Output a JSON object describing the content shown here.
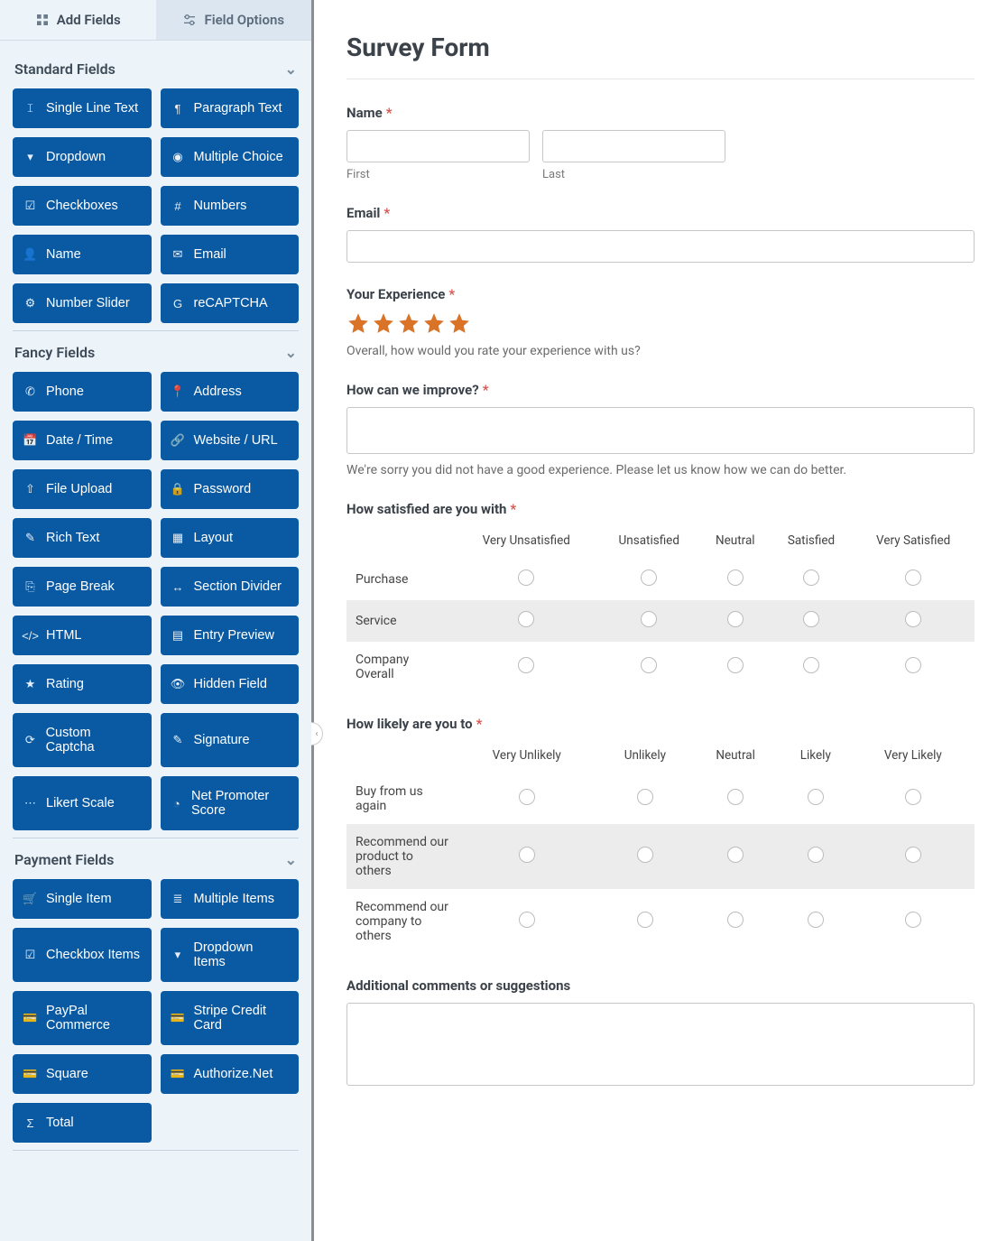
{
  "tabs": {
    "add": "Add Fields",
    "options": "Field Options"
  },
  "sections": {
    "standard": {
      "title": "Standard Fields",
      "items": [
        {
          "icon": "𝙸",
          "label": "Single Line Text"
        },
        {
          "icon": "¶",
          "label": "Paragraph Text"
        },
        {
          "icon": "▾",
          "label": "Dropdown"
        },
        {
          "icon": "◉",
          "label": "Multiple Choice"
        },
        {
          "icon": "☑",
          "label": "Checkboxes"
        },
        {
          "icon": "#",
          "label": "Numbers"
        },
        {
          "icon": "👤",
          "label": "Name"
        },
        {
          "icon": "✉",
          "label": "Email"
        },
        {
          "icon": "⚙",
          "label": "Number Slider"
        },
        {
          "icon": "G",
          "label": "reCAPTCHA"
        }
      ]
    },
    "fancy": {
      "title": "Fancy Fields",
      "items": [
        {
          "icon": "✆",
          "label": "Phone"
        },
        {
          "icon": "📍",
          "label": "Address"
        },
        {
          "icon": "📅",
          "label": "Date / Time"
        },
        {
          "icon": "🔗",
          "label": "Website / URL"
        },
        {
          "icon": "⇧",
          "label": "File Upload"
        },
        {
          "icon": "🔒",
          "label": "Password"
        },
        {
          "icon": "✎",
          "label": "Rich Text"
        },
        {
          "icon": "▦",
          "label": "Layout"
        },
        {
          "icon": "⎘",
          "label": "Page Break"
        },
        {
          "icon": "↔",
          "label": "Section Divider"
        },
        {
          "icon": "</>",
          "label": "HTML"
        },
        {
          "icon": "▤",
          "label": "Entry Preview"
        },
        {
          "icon": "★",
          "label": "Rating"
        },
        {
          "icon": "👁",
          "label": "Hidden Field"
        },
        {
          "icon": "⟳",
          "label": "Custom Captcha"
        },
        {
          "icon": "✎",
          "label": "Signature"
        },
        {
          "icon": "⋯",
          "label": "Likert Scale"
        },
        {
          "icon": "◔",
          "label": "Net Promoter Score"
        }
      ]
    },
    "payment": {
      "title": "Payment Fields",
      "items": [
        {
          "icon": "🛒",
          "label": "Single Item"
        },
        {
          "icon": "≣",
          "label": "Multiple Items"
        },
        {
          "icon": "☑",
          "label": "Checkbox Items"
        },
        {
          "icon": "▾",
          "label": "Dropdown Items"
        },
        {
          "icon": "💳",
          "label": "PayPal Commerce"
        },
        {
          "icon": "💳",
          "label": "Stripe Credit Card"
        },
        {
          "icon": "💳",
          "label": "Square"
        },
        {
          "icon": "💳",
          "label": "Authorize.Net"
        },
        {
          "icon": "Σ",
          "label": "Total"
        }
      ]
    }
  },
  "form": {
    "title": "Survey Form",
    "name": {
      "label": "Name",
      "first": "First",
      "last": "Last"
    },
    "email": {
      "label": "Email"
    },
    "experience": {
      "label": "Your Experience",
      "desc": "Overall, how would you rate your experience with us?",
      "rating": 5
    },
    "improve": {
      "label": "How can we improve?",
      "desc": "We're sorry you did not have a good experience. Please let us know how we can do better."
    },
    "satisfied": {
      "label": "How satisfied are you with",
      "cols": [
        "Very Unsatisfied",
        "Unsatisfied",
        "Neutral",
        "Satisfied",
        "Very Satisfied"
      ],
      "rows": [
        "Purchase",
        "Service",
        "Company Overall"
      ]
    },
    "likely": {
      "label": "How likely are you to",
      "cols": [
        "Very Unlikely",
        "Unlikely",
        "Neutral",
        "Likely",
        "Very Likely"
      ],
      "rows": [
        "Buy from us again",
        "Recommend our product to others",
        "Recommend our company to others"
      ]
    },
    "comments": {
      "label": "Additional comments or suggestions"
    }
  }
}
